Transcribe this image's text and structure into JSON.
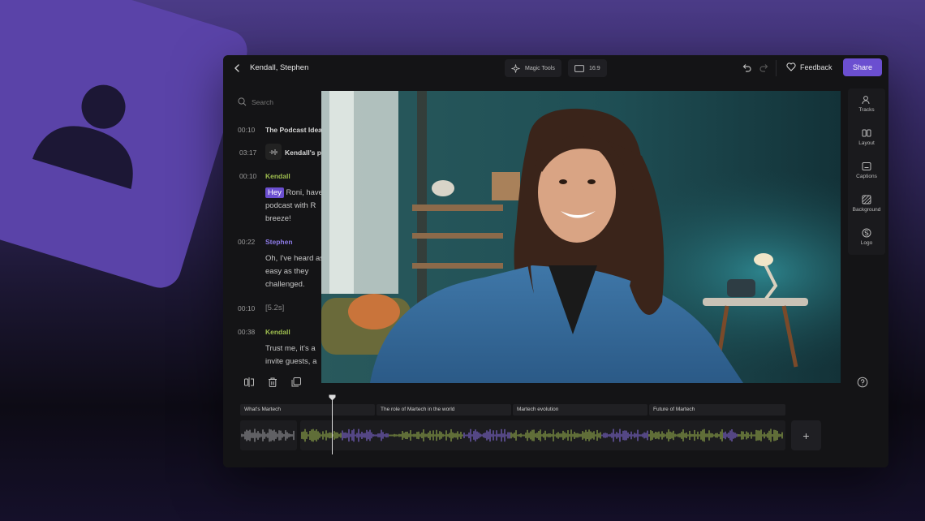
{
  "header": {
    "title": "Kendall, Stephen",
    "magic_tools_label": "Magic Tools",
    "aspect_label": "16:9",
    "feedback_label": "Feedback",
    "share_label": "Share"
  },
  "transcript": {
    "search_placeholder": "Search",
    "rows": [
      {
        "time": "00:10",
        "text": "The Podcast Idea"
      },
      {
        "time": "03:17",
        "text": "Kendall's p"
      },
      {
        "time": "00:10",
        "speaker": "Kendall",
        "highlight": "Hey",
        "text": " Roni, have podcast with R breeze!"
      },
      {
        "time": "00:22",
        "speaker": "Stephen",
        "text": "Oh, I've heard as easy as they challenged."
      },
      {
        "time": "00:10",
        "text": "[5.2s]"
      },
      {
        "time": "00:38",
        "speaker": "Kendall",
        "text": "Trust me, it's a invite guests, a"
      }
    ]
  },
  "right_panel": {
    "items": [
      {
        "label": "Tracks",
        "icon": "tracks-icon"
      },
      {
        "label": "Layout",
        "icon": "layout-icon"
      },
      {
        "label": "Captions",
        "icon": "captions-icon"
      },
      {
        "label": "Background",
        "icon": "background-icon"
      },
      {
        "label": "Logo",
        "icon": "logo-icon"
      }
    ]
  },
  "timeline": {
    "chapters": [
      "What's Martech",
      "The role of Martech in the world",
      "Martech evolution",
      "Future of Martech"
    ],
    "add_label": "+",
    "help_label": "?"
  },
  "colors": {
    "accent": "#6b4fd0",
    "speaker_kendall": "#9fbe4f",
    "speaker_stephen": "#8c7ae6",
    "wave_green": "#8da54a",
    "wave_purple": "#7a64c8"
  }
}
